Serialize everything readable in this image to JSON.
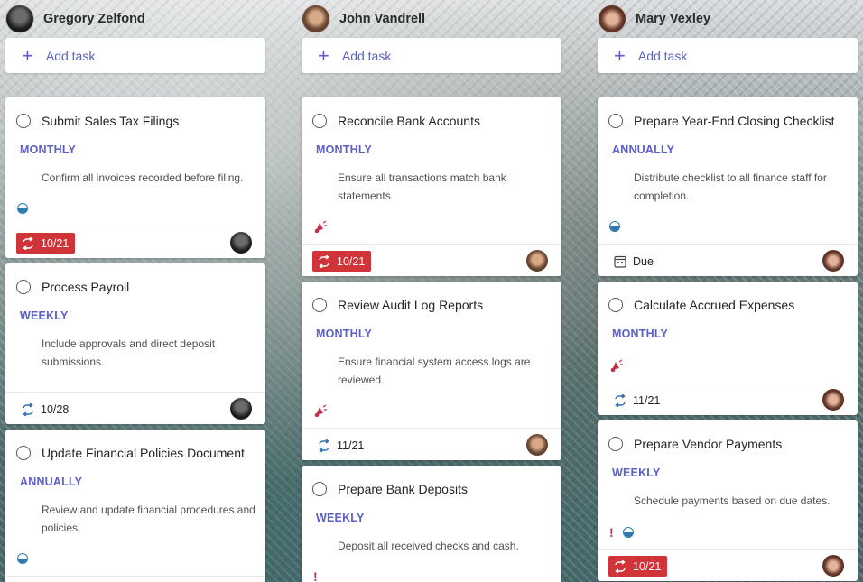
{
  "columns": [
    {
      "name": "Gregory Zelfond",
      "avatar": "avatar-gregory",
      "add_task": "Add task",
      "cards": [
        {
          "title": "Submit Sales Tax Filings",
          "frequency": "MONTHLY",
          "description": "Confirm all invoices recorded before filing.",
          "progress": 0.5,
          "due_label": "10/21",
          "overdue": true
        },
        {
          "title": "Process Payroll",
          "frequency": "WEEKLY",
          "description": "Include approvals and direct deposit submissions.",
          "due_label": "10/28",
          "overdue": false
        },
        {
          "title": "Update Financial Policies Document",
          "frequency": "ANNUALLY",
          "description": "Review and update financial procedures and policies.",
          "progress": 0.5
        }
      ]
    },
    {
      "name": "John Vandrell",
      "avatar": "avatar-john",
      "add_task": "Add task",
      "cards": [
        {
          "title": "Reconcile Bank Accounts",
          "frequency": "MONTHLY",
          "description": "Ensure all transactions match bank statements",
          "priority": "important",
          "due_label": "10/21",
          "overdue": true
        },
        {
          "title": "Review Audit Log Reports",
          "frequency": "MONTHLY",
          "description": "Ensure financial system access logs are reviewed.",
          "priority": "important",
          "due_label": "11/21",
          "overdue": false
        },
        {
          "title": "Prepare Bank Deposits",
          "frequency": "WEEKLY",
          "description": "Deposit all received checks and cash.",
          "priority": "urgent"
        }
      ]
    },
    {
      "name": "Mary Vexley",
      "avatar": "avatar-mary",
      "add_task": "Add task",
      "cards": [
        {
          "title": "Prepare Year-End Closing Checklist",
          "frequency": "ANNUALLY",
          "description": "Distribute checklist to all finance staff for completion.",
          "progress": 0.5,
          "due_label": "Due",
          "overdue": false
        },
        {
          "title": "Calculate Accrued Expenses",
          "frequency": "MONTHLY",
          "description": "",
          "priority": "important",
          "due_label": "11/21",
          "overdue": false
        },
        {
          "title": "Prepare Vendor Payments",
          "frequency": "WEEKLY",
          "description": "Schedule payments based on due dates.",
          "priority": "urgent",
          "progress": 0.5,
          "due_label": "10/21",
          "overdue": true
        }
      ]
    }
  ],
  "colors": {
    "accent": "#5b5fc7",
    "overdue": "#d13438",
    "urgent": "#c4314b",
    "progress": "#2f7bb0"
  }
}
